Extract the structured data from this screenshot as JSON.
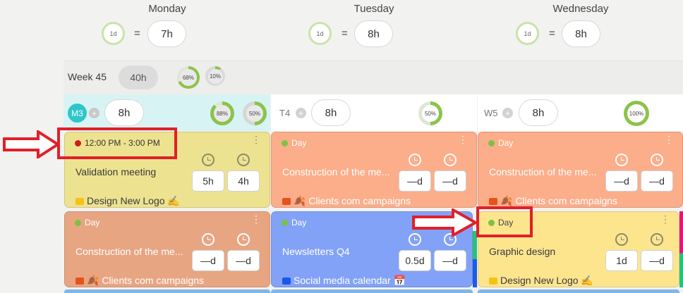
{
  "days": [
    {
      "name": "Monday",
      "ring": "1d",
      "eq": "=",
      "hours": "7h"
    },
    {
      "name": "Tuesday",
      "ring": "1d",
      "eq": "=",
      "hours": "8h"
    },
    {
      "name": "Wednesday",
      "ring": "1d",
      "eq": "=",
      "hours": "8h"
    }
  ],
  "week": {
    "label": "Week 45",
    "hours": "40h",
    "pct1": "68%",
    "pct2": "10%"
  },
  "columns": [
    {
      "code": "M3",
      "hours": "8h",
      "pct1": "88%",
      "pct2": "50%"
    },
    {
      "code": "T4",
      "hours": "8h",
      "pct1": "50%"
    },
    {
      "code": "W5",
      "hours": "8h",
      "pct1": "100%"
    }
  ],
  "cards": {
    "c1": {
      "time": "12:00 PM - 3:00 PM",
      "title": "Validation meeting",
      "v1": "5h",
      "v2": "4h",
      "project": "Design New Logo ✍"
    },
    "c2": {
      "time": "Day",
      "title": "Construction of the me...",
      "v1": "—d",
      "v2": "—d",
      "project": "🍂 Clients com campaigns"
    },
    "c3": {
      "time": "Day",
      "title": "Construction of the me...",
      "v1": "—d",
      "v2": "—d",
      "project": "🍂 Clients com campaigns"
    },
    "c4": {
      "time": "Day",
      "title": "Construction of the me...",
      "v1": "—d",
      "v2": "—d",
      "project": "🍂 Clients com campaigns"
    },
    "c5": {
      "time": "Day",
      "title": "Newsletters Q4",
      "v1": "0.5d",
      "v2": "—d",
      "project": "Social media calendar 📅"
    },
    "c6": {
      "time": "Day",
      "title": "Graphic design",
      "v1": "1d",
      "v2": "—d",
      "project": "Design New Logo ✍"
    }
  },
  "colors": {
    "yellow": "#ede28f",
    "salmon": "#fcad8a",
    "orange": "#e8a582",
    "blue": "#82a2f7",
    "lightyellow": "#fde58e",
    "highlight": "#e0202a"
  }
}
